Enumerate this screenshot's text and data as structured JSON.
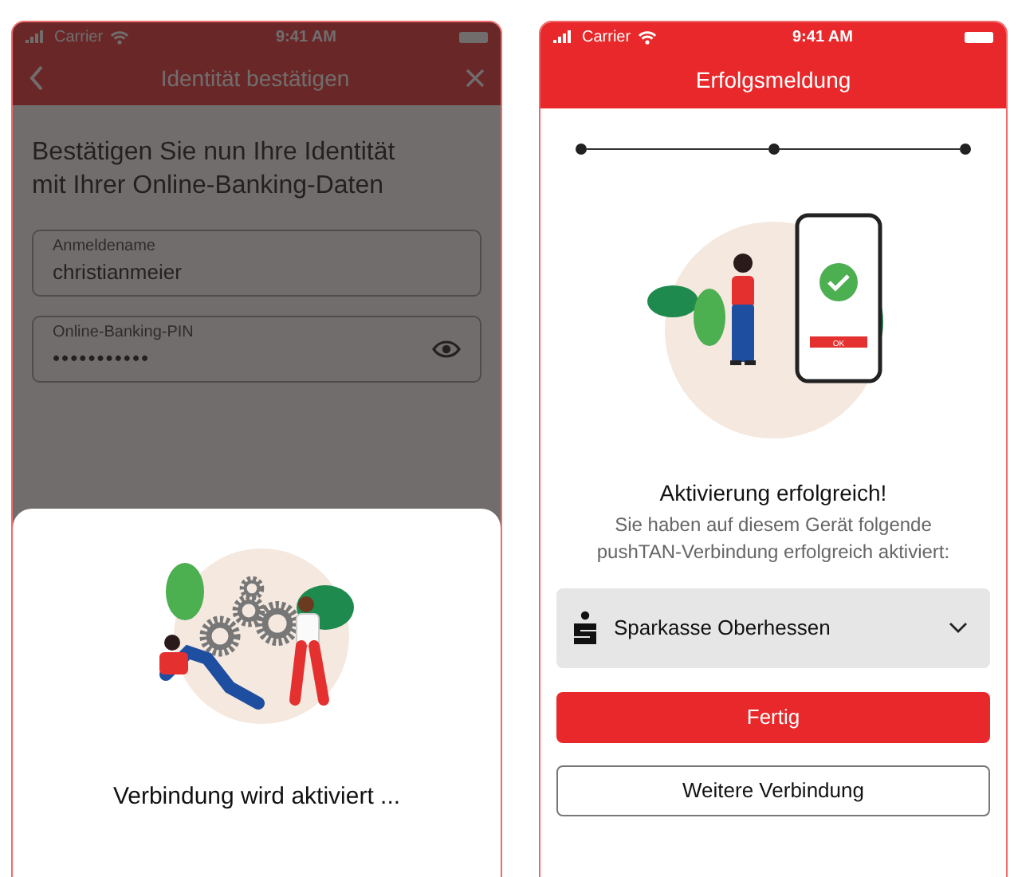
{
  "screens": [
    {
      "status_bar": {
        "carrier": "Carrier",
        "time": "9:41 AM"
      },
      "header": {
        "title": "Identität bestätigen"
      },
      "dimmed": true,
      "heading": "Bestätigen Sie nun Ihre Identität mit Ihrer Online-Banking-Daten",
      "fields": [
        {
          "label": "Anmeldename",
          "value": "christianmeier",
          "kind": "text"
        },
        {
          "label": "Online-Banking-PIN",
          "value": "•••••••••••",
          "kind": "password"
        }
      ],
      "sheet": {
        "message": "Verbindung wird aktiviert ..."
      }
    },
    {
      "status_bar": {
        "carrier": "Carrier",
        "time": "9:41 AM"
      },
      "header": {
        "title": "Erfolgsmeldung"
      },
      "steps": [
        {
          "completed": true
        },
        {
          "completed": true
        },
        {
          "completed": true
        }
      ],
      "title": "Aktivierung erfolgreich!",
      "description": "Sie haben auf diesem Gerät folgende pushTAN-Verbindung erfolgreich aktiviert:",
      "bank": {
        "name": "Sparkasse Oberhessen"
      },
      "phone_ok": "OK",
      "buttons": [
        {
          "label": "Fertig",
          "kind": "primary"
        },
        {
          "label": "Weitere Verbindung",
          "kind": "secondary"
        }
      ]
    }
  ]
}
